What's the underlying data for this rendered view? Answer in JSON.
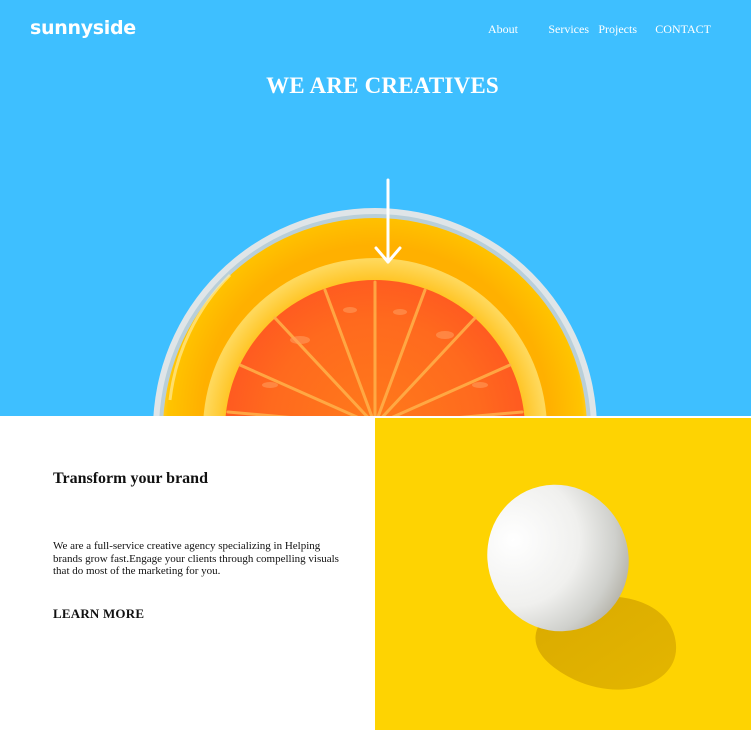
{
  "header": {
    "logo": "sunnyside",
    "nav": [
      "About",
      "Services",
      "Projects",
      "CONTACT"
    ]
  },
  "hero": {
    "title": "WE ARE CREATIVES",
    "background_color": "#3ebfff",
    "image": "orange-half",
    "arrow_icon": "arrow-down-icon"
  },
  "transform": {
    "title": "Transform your brand",
    "body": "We are a full-service creative agency specializing in Helping brands grow fast.Engage your clients through compelling visuals that do most of the marketing for you.",
    "cta": "LEARN MORE"
  },
  "egg_panel": {
    "background_color": "#fed302",
    "image": "egg"
  }
}
